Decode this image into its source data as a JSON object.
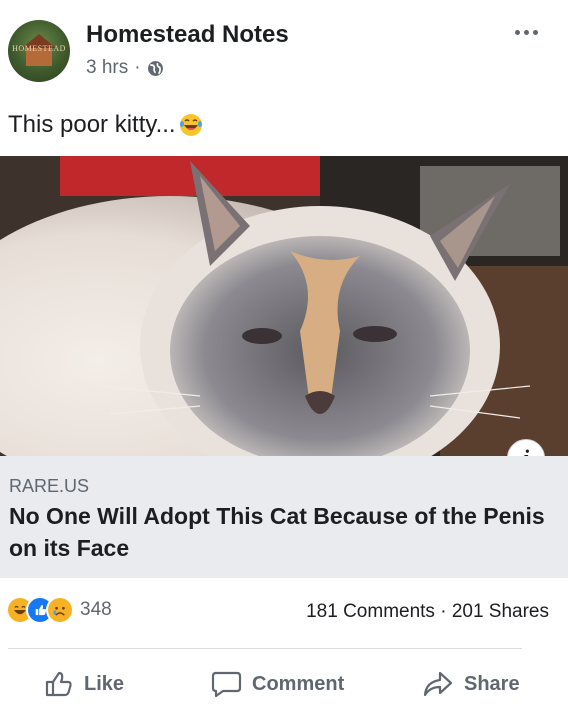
{
  "post": {
    "page_name": "Homestead Notes",
    "avatar_text": "HOMESTEAD",
    "time": "3 hrs",
    "separator": "·",
    "privacy_icon": "globe-icon",
    "more_icon": "more-dots-icon",
    "caption": "This poor kitty...",
    "caption_emoji": "laughing-tears-emoji"
  },
  "link": {
    "image_alt": "cat-photo",
    "domain": "RARE.US",
    "title": "No One Will Adopt This Cat Because of the Penis on its Face",
    "info_label": "i"
  },
  "engagement": {
    "reaction_icons": [
      "haha-reaction-icon",
      "like-reaction-icon",
      "sad-reaction-icon"
    ],
    "reaction_count": "348",
    "comments_shares": "181 Comments · 201 Shares"
  },
  "actions": {
    "like_label": "Like",
    "comment_label": "Comment",
    "share_label": "Share"
  },
  "colors": {
    "link_preview_bg": "#e9ebee",
    "meta_text": "#606770",
    "like_blue": "#1877f2",
    "reaction_yellow": "#f7b125"
  }
}
